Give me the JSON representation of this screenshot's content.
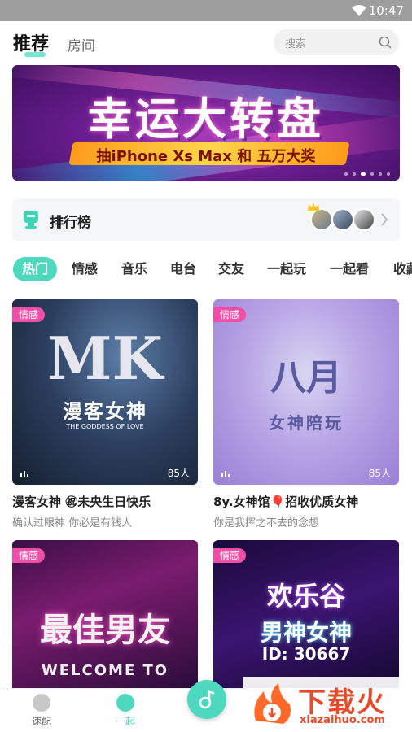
{
  "status": {
    "time": "10:47"
  },
  "top_nav": {
    "tab_recommend": "推荐",
    "tab_room": "房间",
    "search_placeholder": "搜索"
  },
  "banner": {
    "title": "幸运大转盘",
    "subtitle": "抽iPhone Xs Max 和 五万大奖"
  },
  "ranking": {
    "label": "排行榜"
  },
  "categories": [
    "热门",
    "情感",
    "音乐",
    "电台",
    "交友",
    "一起玩",
    "一起看",
    "收藏"
  ],
  "rooms": [
    {
      "tag": "情感",
      "count": "85人",
      "title": "漫客女神 ㊗未央生日快乐",
      "desc": "确认过眼神 你必是有钱人",
      "art_main": "漫客女神",
      "art_big": "MK",
      "art_small": "THE GODDESS OF LOVE"
    },
    {
      "tag": "情感",
      "count": "85人",
      "title": "8y.女神馆🎈招收优质女神",
      "desc": "你是我挥之不去的念想",
      "art_main": "八月",
      "art_sub": "女神陪玩"
    },
    {
      "tag": "情感",
      "art_main": "最佳男友",
      "art_sub": "WELCOME TO"
    },
    {
      "tag": "情感",
      "art_main": "欢乐谷",
      "art_sub": "男神女神",
      "art_id": "ID: 30667"
    }
  ],
  "bottom_nav": {
    "tab1": "速配",
    "tab2": "一起"
  },
  "watermark": {
    "brand": "下载火",
    "url": "xiazaihuo.com"
  },
  "colors": {
    "accent": "#4ed8be",
    "tag": "#f04fa8",
    "watermark": "#e84b2a"
  }
}
